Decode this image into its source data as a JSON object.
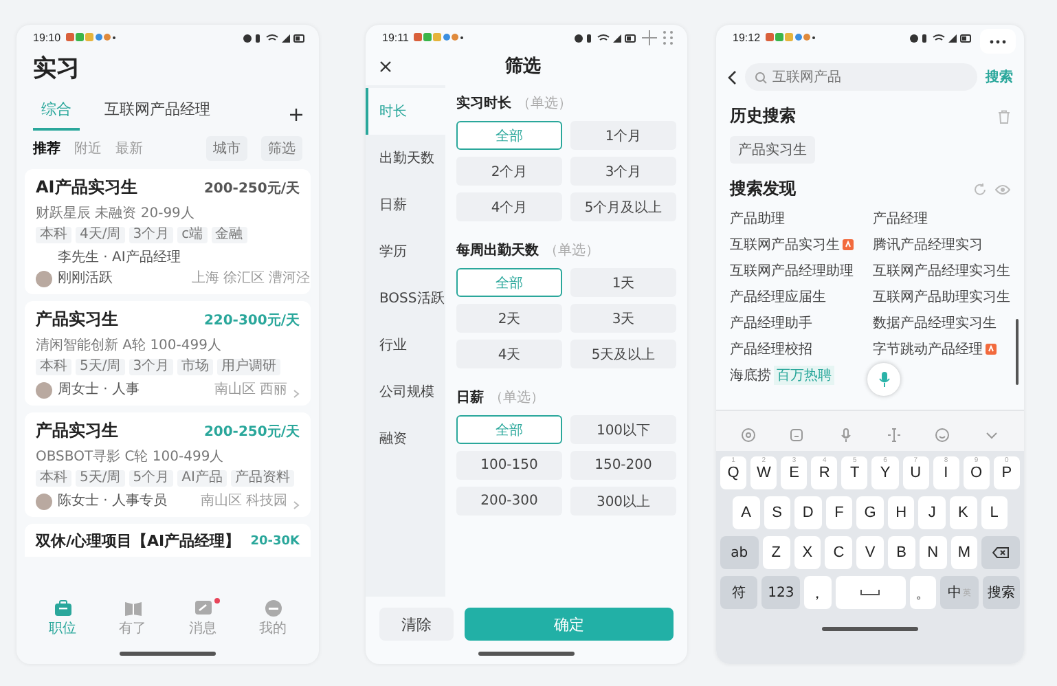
{
  "left_phone": {
    "status_time": "19:10",
    "title": "实习",
    "tabs": [
      {
        "label": "综合",
        "selected": true
      },
      {
        "label": "互联网产品经理",
        "selected": false
      }
    ],
    "sort_tabs": [
      {
        "label": "推荐",
        "selected": true
      },
      {
        "label": "附近",
        "selected": false
      },
      {
        "label": "最新",
        "selected": false
      }
    ],
    "filters": [
      "城市",
      "筛选"
    ],
    "jobs": [
      {
        "title": "AI产品实习生",
        "salary": "200-250元/天",
        "color": "#555555",
        "company": "财跃星辰 未融资 20-99人",
        "tags": [
          "本科",
          "4天/周",
          "3个月",
          "c端",
          "金融"
        ],
        "recruiter": "李先生 · AI产品经理",
        "recruiter_status": "刚刚活跃",
        "location": "上海 徐汇区 漕河泾"
      },
      {
        "title": "产品实习生",
        "salary": "220-300元/天",
        "color": "#2aa79b",
        "company": "清闲智能创新 A轮 100-499人",
        "tags": [
          "本科",
          "5天/周",
          "3个月",
          "市场",
          "用户调研"
        ],
        "recruiter": "周女士 · 人事",
        "location": "南山区 西丽"
      },
      {
        "title": "产品实习生",
        "salary": "200-250元/天",
        "color": "#2aa79b",
        "company": "OBSBOT寻影 C轮 100-499人",
        "tags": [
          "本科",
          "5天/周",
          "5个月",
          "AI产品",
          "产品资料"
        ],
        "recruiter": "陈女士 · 人事专员",
        "location": "南山区 科技园"
      },
      {
        "title": "双休/心理项目【AI产品经理】",
        "salary": "20-30K",
        "color": "#2aa79b"
      }
    ],
    "nav": [
      {
        "label": "职位",
        "kind": "jobs",
        "selected": true,
        "badge": false
      },
      {
        "label": "有了",
        "kind": "book",
        "selected": false,
        "badge": false
      },
      {
        "label": "消息",
        "kind": "chat",
        "selected": false,
        "badge": true
      },
      {
        "label": "我的",
        "kind": "profile",
        "selected": false,
        "badge": false
      }
    ]
  },
  "filter_phone": {
    "status_time": "19:11",
    "title": "筛选",
    "menu": [
      {
        "label": "时长",
        "selected": true
      },
      {
        "label": "出勤天数",
        "selected": false
      },
      {
        "label": "日薪",
        "selected": false
      },
      {
        "label": "学历",
        "selected": false
      },
      {
        "label": "BOSS活跃",
        "selected": false
      },
      {
        "label": "行业",
        "selected": false
      },
      {
        "label": "公司规模",
        "selected": false
      },
      {
        "label": "融资",
        "selected": false
      }
    ],
    "sections": [
      {
        "title": "实习时长",
        "hint": "（单选）",
        "options": [
          {
            "label": "全部",
            "selected": true
          },
          {
            "label": "1个月",
            "selected": false
          },
          {
            "label": "2个月",
            "selected": false
          },
          {
            "label": "3个月",
            "selected": false
          },
          {
            "label": "4个月",
            "selected": false
          },
          {
            "label": "5个月及以上",
            "selected": false
          }
        ]
      },
      {
        "title": "每周出勤天数",
        "hint": "（单选）",
        "options": [
          {
            "label": "全部",
            "selected": true
          },
          {
            "label": "1天",
            "selected": false
          },
          {
            "label": "2天",
            "selected": false
          },
          {
            "label": "3天",
            "selected": false
          },
          {
            "label": "4天",
            "selected": false
          },
          {
            "label": "5天及以上",
            "selected": false
          }
        ]
      },
      {
        "title": "日薪",
        "hint": "（单选）",
        "options": [
          {
            "label": "全部",
            "selected": true
          },
          {
            "label": "100以下",
            "selected": false
          },
          {
            "label": "100-150",
            "selected": false
          },
          {
            "label": "150-200",
            "selected": false
          },
          {
            "label": "200-300",
            "selected": false
          },
          {
            "label": "300以上",
            "selected": false
          }
        ]
      }
    ],
    "clear_button": "清除",
    "confirm_button": "确定"
  },
  "search_phone": {
    "status_time": "19:12",
    "search": {
      "placeholder": "互联网产品",
      "button": "搜索"
    },
    "history": {
      "title": "历史搜索",
      "items": [
        "产品实习生"
      ]
    },
    "discover": {
      "title": "搜索发现",
      "items": [
        {
          "label": "产品助理",
          "hot": false
        },
        {
          "label": "产品经理",
          "hot": false
        },
        {
          "label": "互联网产品实习生",
          "hot": true
        },
        {
          "label": "腾讯产品经理实习",
          "hot": false
        },
        {
          "label": "互联网产品经理助理",
          "hot": false
        },
        {
          "label": "互联网产品经理实习生",
          "hot": false
        },
        {
          "label": "产品经理应届生",
          "hot": false
        },
        {
          "label": "互联网产品助理实习生",
          "hot": false
        },
        {
          "label": "产品经理助手",
          "hot": false
        },
        {
          "label": "数据产品经理实习生",
          "hot": false
        },
        {
          "label": "产品经理校招",
          "hot": false
        },
        {
          "label": "字节跳动产品经理",
          "hot": true
        },
        {
          "label": "海底捞",
          "hot": false,
          "tag": "百万热聘"
        }
      ]
    },
    "keyboard": {
      "rows": [
        {
          "keys": [
            {
              "label": "Q",
              "hint": "1",
              "kind": "char"
            },
            {
              "label": "W",
              "hint": "2",
              "kind": "char"
            },
            {
              "label": "E",
              "hint": "3",
              "kind": "char"
            },
            {
              "label": "R",
              "hint": "4",
              "kind": "char"
            },
            {
              "label": "T",
              "hint": "5",
              "kind": "char"
            },
            {
              "label": "Y",
              "hint": "6",
              "kind": "char"
            },
            {
              "label": "U",
              "hint": "7",
              "kind": "char"
            },
            {
              "label": "I",
              "hint": "8",
              "kind": "char"
            },
            {
              "label": "O",
              "hint": "9",
              "kind": "char"
            },
            {
              "label": "P",
              "hint": "0",
              "kind": "char"
            }
          ]
        },
        {
          "keys": [
            {
              "label": "A",
              "kind": "char"
            },
            {
              "label": "S",
              "kind": "char"
            },
            {
              "label": "D",
              "kind": "char"
            },
            {
              "label": "F",
              "kind": "char"
            },
            {
              "label": "G",
              "kind": "char"
            },
            {
              "label": "H",
              "kind": "char"
            },
            {
              "label": "J",
              "kind": "char"
            },
            {
              "label": "K",
              "kind": "char"
            },
            {
              "label": "L",
              "kind": "char"
            }
          ]
        },
        {
          "keys": [
            {
              "label": "ab",
              "kind": "fn"
            },
            {
              "label": "Z",
              "kind": "char"
            },
            {
              "label": "X",
              "kind": "char"
            },
            {
              "label": "C",
              "kind": "char"
            },
            {
              "label": "V",
              "kind": "char"
            },
            {
              "label": "B",
              "kind": "char"
            },
            {
              "label": "N",
              "kind": "char"
            },
            {
              "label": "M",
              "kind": "char"
            },
            {
              "kind": "delete"
            }
          ]
        },
        {
          "keys": [
            {
              "label": "符",
              "kind": "fn"
            },
            {
              "label": "123",
              "kind": "fn"
            },
            {
              "label": "，",
              "kind": "char"
            },
            {
              "kind": "space"
            },
            {
              "label": "。",
              "kind": "char"
            },
            {
              "label": "中",
              "hint": "英",
              "kind": "fn"
            },
            {
              "label": "搜索",
              "kind": "fn"
            }
          ]
        }
      ]
    }
  }
}
